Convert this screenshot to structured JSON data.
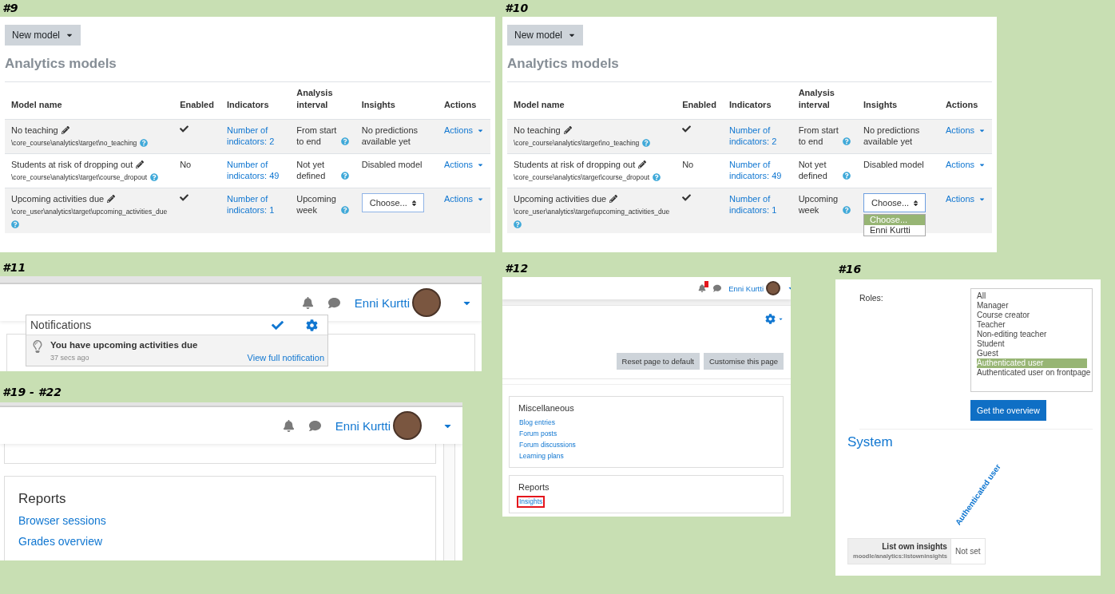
{
  "panels": [
    {
      "kind": "models",
      "label": "#9",
      "new_model": "New model",
      "title": "Analytics models",
      "columns": [
        "Model name",
        "Enabled",
        "Indicators",
        "Analysis interval",
        "Insights",
        "Actions"
      ],
      "rows": [
        {
          "name": "No teaching",
          "path": "\\core_course\\analytics\\target\\no_teaching",
          "enabled": true,
          "indicators": "Number of indicators: 2",
          "interval": "From start to end",
          "insights": {
            "kind": "text",
            "text": "No predictions available yet"
          },
          "actions": "Actions"
        },
        {
          "name": "Students at risk of dropping out",
          "path": "\\core_course\\analytics\\target\\course_dropout",
          "enabled": false,
          "enabled_label": "No",
          "indicators": "Number of indicators: 49",
          "interval": "Not yet defined",
          "insights": {
            "kind": "text",
            "text": "Disabled model"
          },
          "actions": "Actions"
        },
        {
          "name": "Upcoming activities due",
          "path": "\\core_user\\analytics\\target\\upcoming_activities_due",
          "enabled": true,
          "indicators": "Number of indicators: 1",
          "interval": "Upcoming week",
          "insights": {
            "kind": "select",
            "value": "Choose...",
            "open": false
          },
          "actions": "Actions"
        }
      ]
    },
    {
      "kind": "models",
      "label": "#10",
      "new_model": "New model",
      "title": "Analytics models",
      "columns": [
        "Model name",
        "Enabled",
        "Indicators",
        "Analysis interval",
        "Insights",
        "Actions"
      ],
      "rows": [
        {
          "name": "No teaching",
          "path": "\\core_course\\analytics\\target\\no_teaching",
          "enabled": true,
          "indicators": "Number of indicators: 2",
          "interval": "From start to end",
          "insights": {
            "kind": "text",
            "text": "No predictions available yet"
          },
          "actions": "Actions"
        },
        {
          "name": "Students at risk of dropping out",
          "path": "\\core_course\\analytics\\target\\course_dropout",
          "enabled": false,
          "enabled_label": "No",
          "indicators": "Number of indicators: 49",
          "interval": "Not yet defined",
          "insights": {
            "kind": "text",
            "text": "Disabled model"
          },
          "actions": "Actions"
        },
        {
          "name": "Upcoming activities due",
          "path": "\\core_user\\analytics\\target\\upcoming_activities_due",
          "enabled": true,
          "indicators": "Number of indicators: 1",
          "interval": "Upcoming week",
          "insights": {
            "kind": "select",
            "value": "Choose...",
            "open": true,
            "options": [
              {
                "text": "Choose...",
                "selected": true
              },
              {
                "text": "Enni Kurtti",
                "selected": false
              }
            ]
          },
          "actions": "Actions"
        }
      ]
    },
    {
      "kind": "notifications",
      "label": "#11",
      "user": "Enni Kurtti",
      "popover": {
        "title": "Notifications",
        "items": [
          {
            "text": "You have upcoming activities due",
            "time": "37 secs ago",
            "link": "View full notification"
          }
        ]
      }
    },
    {
      "kind": "dashboard",
      "label": "#12",
      "user": "Enni Kurtti",
      "bell_badge": true,
      "buttons": [
        "Reset page to default",
        "Customise this page"
      ],
      "cards": [
        {
          "title": "Miscellaneous",
          "links": [
            {
              "text": "Blog entries",
              "highlighted": false
            },
            {
              "text": "Forum posts",
              "highlighted": false
            },
            {
              "text": "Forum discussions",
              "highlighted": false
            },
            {
              "text": "Learning plans",
              "highlighted": false
            }
          ]
        },
        {
          "title": "Reports",
          "links": [
            {
              "text": "Insights",
              "highlighted": true
            }
          ]
        }
      ]
    },
    {
      "kind": "overview",
      "label": "#16",
      "roles_label": "Roles:",
      "roles": [
        {
          "text": "All",
          "selected": false
        },
        {
          "text": "Manager",
          "selected": false
        },
        {
          "text": "Course creator",
          "selected": false
        },
        {
          "text": "Teacher",
          "selected": false
        },
        {
          "text": "Non-editing teacher",
          "selected": false
        },
        {
          "text": "Student",
          "selected": false
        },
        {
          "text": "Guest",
          "selected": false
        },
        {
          "text": "Authenticated user",
          "selected": true
        },
        {
          "text": "Authenticated user on frontpage",
          "selected": false
        }
      ],
      "button": "Get the overview",
      "heading": "System",
      "column_header": "Authenticated user",
      "capability": {
        "name": "List own insights",
        "code": "moodle/analytics:listowninsights",
        "value": "Not set"
      }
    },
    {
      "kind": "reports",
      "label": "#19 - #22",
      "user": "Enni Kurtti",
      "card": {
        "title": "Reports",
        "links": [
          "Browser sessions",
          "Grades overview"
        ]
      }
    }
  ]
}
